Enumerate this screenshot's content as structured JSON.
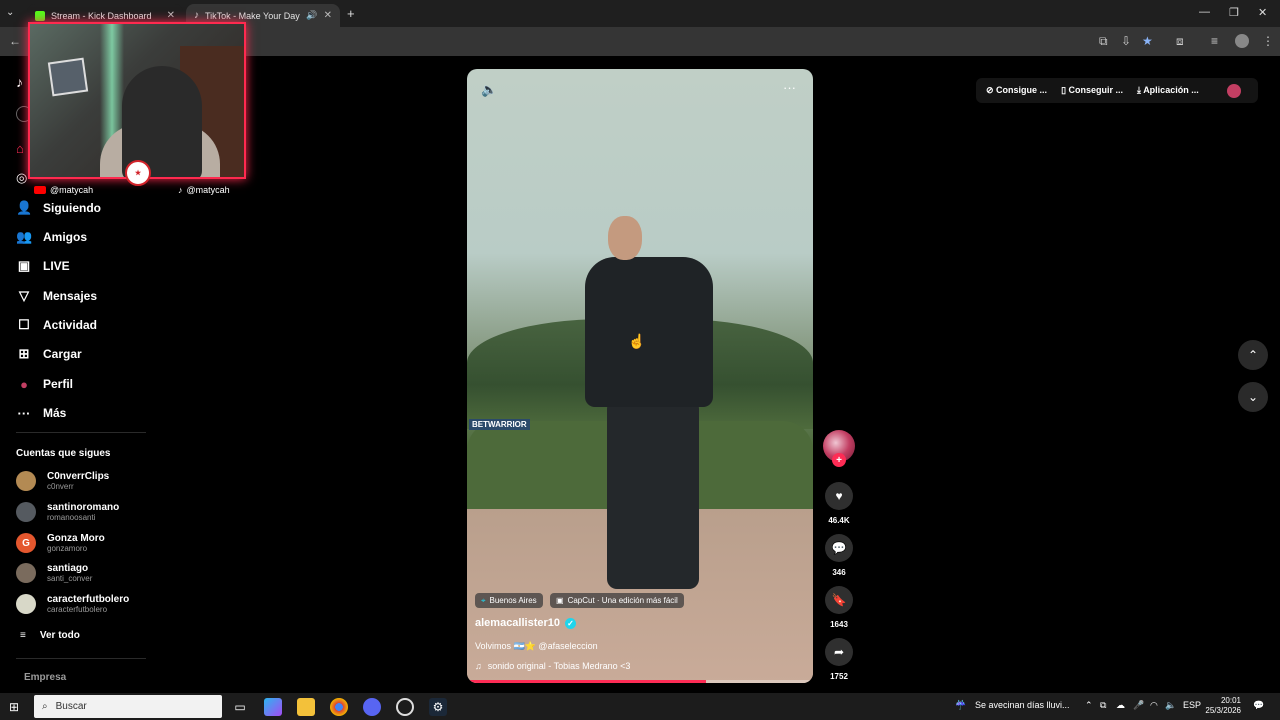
{
  "browser": {
    "tabs": [
      {
        "title": "Stream - Kick Dashboard",
        "active": false
      },
      {
        "title": "TikTok - Make Your Day",
        "active": true
      }
    ]
  },
  "webcam": {
    "handles": [
      "@matycah",
      "@matycah"
    ]
  },
  "sidebar": {
    "nav": [
      {
        "label": "Siguiendo",
        "icon": "following-icon"
      },
      {
        "label": "Amigos",
        "icon": "friends-icon"
      },
      {
        "label": "LIVE",
        "icon": "live-icon"
      },
      {
        "label": "Mensajes",
        "icon": "messages-icon"
      },
      {
        "label": "Actividad",
        "icon": "activity-icon"
      },
      {
        "label": "Cargar",
        "icon": "upload-icon"
      },
      {
        "label": "Perfil",
        "icon": "profile-icon"
      },
      {
        "label": "Más",
        "icon": "more-icon"
      }
    ],
    "following_title": "Cuentas que sigues",
    "following": [
      {
        "name": "C0nverrClips",
        "user": "c0nverr",
        "initial": ""
      },
      {
        "name": "santinoromano",
        "user": "romanoosanti",
        "initial": ""
      },
      {
        "name": "Gonza Moro",
        "user": "gonzamoro",
        "initial": "G"
      },
      {
        "name": "santiago",
        "user": "santi_conver",
        "initial": ""
      },
      {
        "name": "caracterfutbolero",
        "user": "caracterfutbolero",
        "initial": ""
      }
    ],
    "see_all": "Ver todo",
    "company": "Empresa"
  },
  "video": {
    "watermark": "BETWARRIOR",
    "location": "Buenos Aires",
    "capcut": "CapCut · Una edición más fácil",
    "author": "alemacallister10",
    "caption": "Volvimos 🇦🇷⭐ @afaseleccion",
    "sound": "sonido original - Tobias Medrano <3",
    "progress": 0.69
  },
  "actions": {
    "likes": "46.4K",
    "comments": "346",
    "saves": "1643",
    "shares": "1752"
  },
  "top_links": [
    "Consigue ...",
    "Conseguir ...",
    "Aplicación ..."
  ],
  "taskbar": {
    "search": "Buscar",
    "weather": "Se avecinan días lluvi...",
    "lang": "ESP",
    "time": "20:01",
    "date": "25/3/2026"
  }
}
